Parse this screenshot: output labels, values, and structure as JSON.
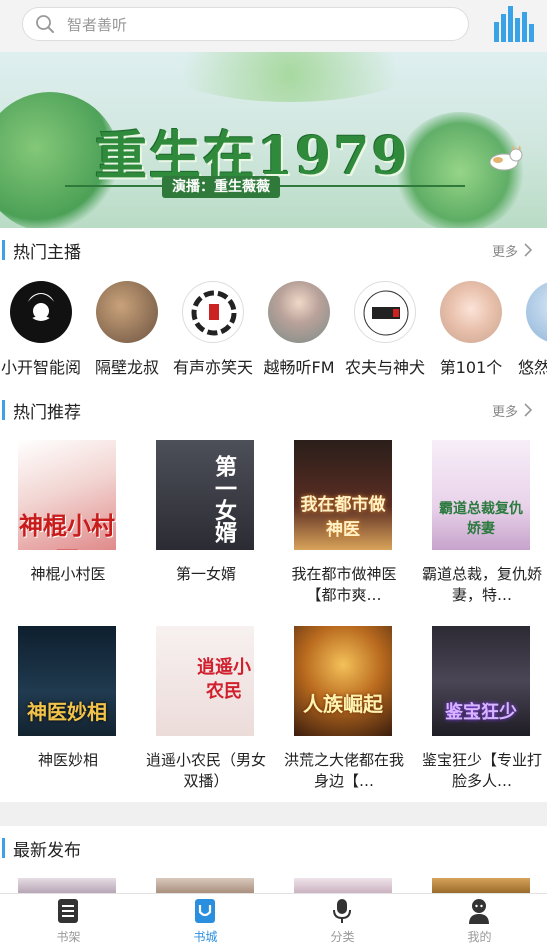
{
  "search": {
    "placeholder": "智者善听"
  },
  "banner": {
    "title": "重生在1979",
    "subtitle": "演播：重生薇薇"
  },
  "hot_anchors": {
    "title": "热门主播",
    "more": "更多",
    "items": [
      {
        "name": "小开智能阅"
      },
      {
        "name": "隔壁龙叔"
      },
      {
        "name": "有声亦笑天"
      },
      {
        "name": "越畅听FM"
      },
      {
        "name": "农夫与神犬"
      },
      {
        "name": "第101个"
      },
      {
        "name": "悠然"
      }
    ]
  },
  "hot_recommend": {
    "title": "热门推荐",
    "more": "更多",
    "books": [
      {
        "title": "神棍小村医",
        "cover_text": "神棍小村医"
      },
      {
        "title": "第一女婿",
        "cover_text": "第一女婿"
      },
      {
        "title": "我在都市做神医【都市爽…",
        "cover_text": "我在都市做神医"
      },
      {
        "title": "霸道总裁，复仇娇妻，特…",
        "cover_text": "霸道总裁复仇娇妻"
      },
      {
        "title": "神医妙相",
        "cover_text": "神医妙相"
      },
      {
        "title": "逍遥小农民（男女双播）",
        "cover_text": "逍遥小农民"
      },
      {
        "title": "洪荒之大佬都在我身边【…",
        "cover_text": "人族崛起"
      },
      {
        "title": "鉴宝狂少【专业打脸多人…",
        "cover_text": "鉴宝狂少"
      }
    ]
  },
  "latest": {
    "title": "最新发布"
  },
  "bottom_nav": [
    {
      "label": "书架",
      "icon": "bookshelf-icon"
    },
    {
      "label": "书城",
      "icon": "bookstore-icon",
      "active": true
    },
    {
      "label": "分类",
      "icon": "microphone-icon"
    },
    {
      "label": "我的",
      "icon": "profile-icon"
    }
  ],
  "colors": {
    "accent": "#2b8fe0",
    "section_bar": "#3fa0e8",
    "divider": "#f0f0f0"
  }
}
